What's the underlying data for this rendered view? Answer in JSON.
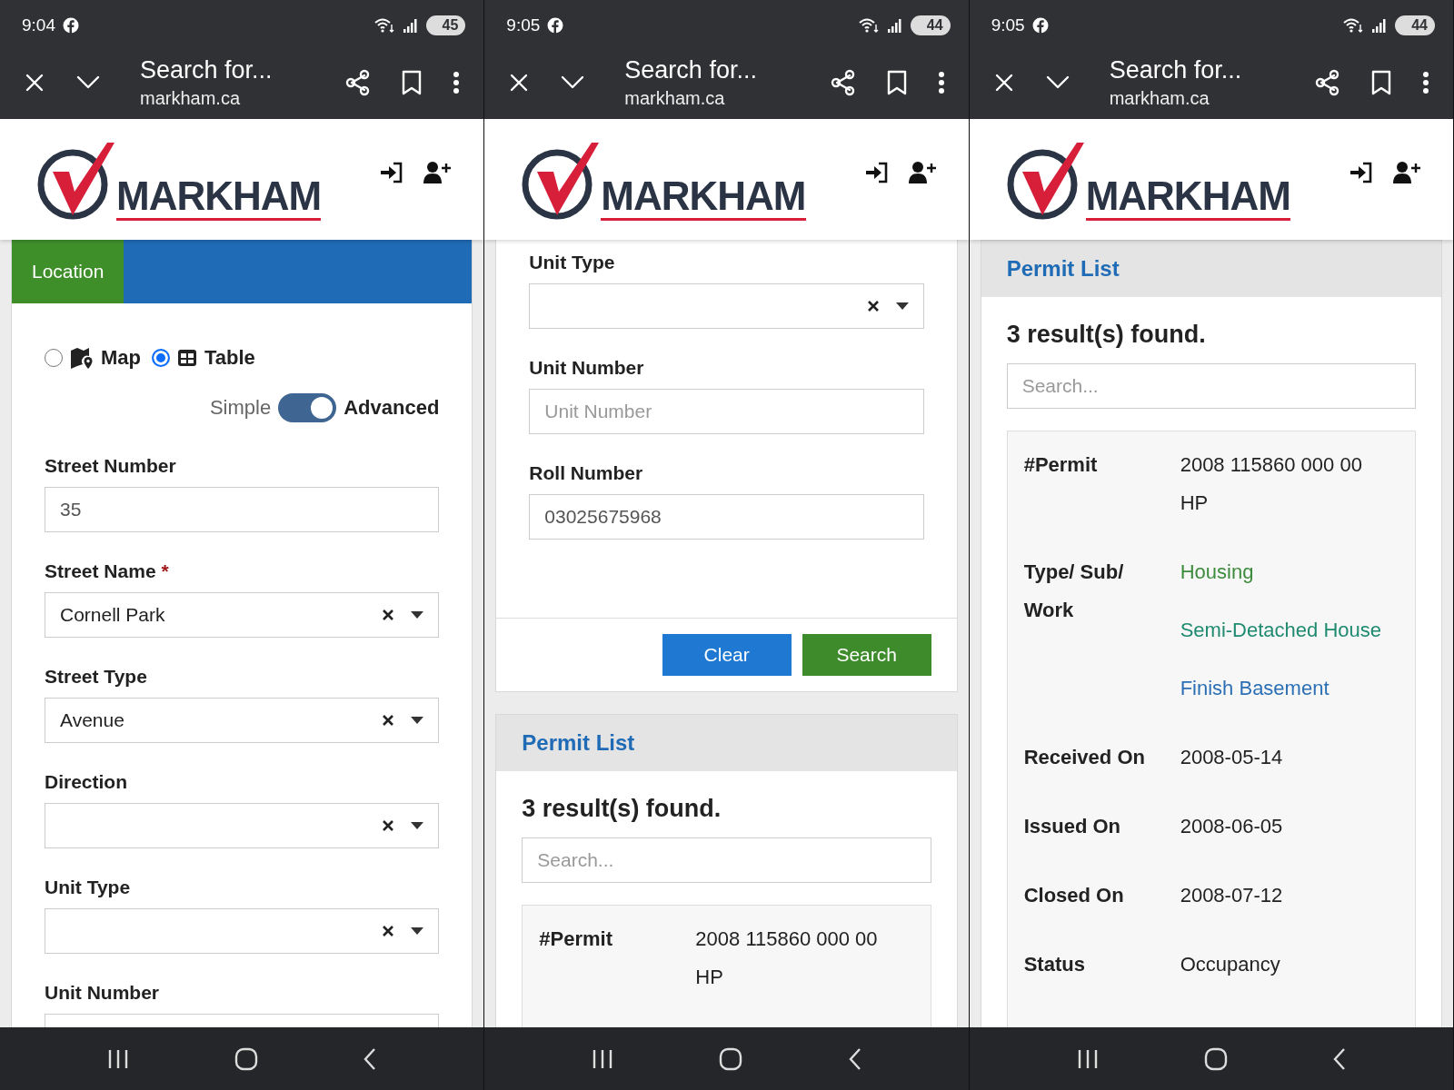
{
  "screens": [
    {
      "status_bar": {
        "time": "9:04",
        "battery": "45"
      },
      "browser_bar": {
        "title": "Search for...",
        "url": "markham.ca"
      },
      "site_header": {
        "logo": "MARKHAM"
      },
      "cards": [
        {
          "tabs": [
            {
              "label": "Location",
              "selected": true
            }
          ],
          "blocks": [
            {
              "kind": "view-switch",
              "options": [
                {
                  "kind": "map",
                  "label": "Map",
                  "selected": false
                },
                {
                  "kind": "table",
                  "label": "Table",
                  "selected": true
                }
              ]
            },
            {
              "kind": "toggle",
              "off_label": "Simple",
              "on_label": "Advanced",
              "on": true
            },
            {
              "kind": "text",
              "label": "Street Number",
              "value": "35"
            },
            {
              "kind": "select",
              "label": "Street Name",
              "required_mark": "*",
              "value": "Cornell Park"
            },
            {
              "kind": "select",
              "label": "Street Type",
              "value": "Avenue"
            },
            {
              "kind": "select",
              "label": "Direction"
            },
            {
              "kind": "select",
              "label": "Unit Type"
            },
            {
              "kind": "text",
              "label": "Unit Number"
            }
          ]
        }
      ]
    },
    {
      "status_bar": {
        "time": "9:05",
        "battery": "44"
      },
      "browser_bar": {
        "title": "Search for...",
        "url": "markham.ca"
      },
      "site_header": {
        "logo": "MARKHAM"
      },
      "cards": [
        {
          "blocks": [
            {
              "kind": "select",
              "label": "Unit Type"
            },
            {
              "kind": "text",
              "label": "Unit Number",
              "placeholder": "Unit Number"
            },
            {
              "kind": "text",
              "label": "Roll Number",
              "value": "03025675968"
            }
          ],
          "actions": [
            {
              "kind": "secondary",
              "label": "Clear"
            },
            {
              "kind": "primary",
              "label": "Search"
            }
          ]
        },
        {
          "heading": "Permit List",
          "result_count": "3 result(s) found.",
          "search": {
            "placeholder": "Search..."
          },
          "record": [
            {
              "label": "#Permit",
              "values": [
                {
                  "text": "2008 115860 000 00 HP"
                }
              ]
            }
          ]
        }
      ]
    },
    {
      "status_bar": {
        "time": "9:05",
        "battery": "44"
      },
      "browser_bar": {
        "title": "Search for...",
        "url": "markham.ca"
      },
      "site_header": {
        "logo": "MARKHAM"
      },
      "cards": [
        {
          "heading": "Permit List",
          "result_count": "3 result(s) found.",
          "search": {
            "placeholder": "Search..."
          },
          "record": [
            {
              "label": "#Permit",
              "values": [
                {
                  "text": "2008 115860 000 00 HP"
                }
              ]
            },
            {
              "label": "Type/ Sub/ Work",
              "values": [
                {
                  "text": "Housing",
                  "color": "#3d8b3d"
                },
                {
                  "text": "Semi-Detached House",
                  "color": "#1f8a70"
                },
                {
                  "text": "Finish Basement",
                  "color": "#2c6fb5"
                }
              ]
            },
            {
              "label": "Received On",
              "values": [
                {
                  "text": "2008-05-14"
                }
              ]
            },
            {
              "label": "Issued On",
              "values": [
                {
                  "text": "2008-06-05"
                }
              ]
            },
            {
              "label": "Closed On",
              "values": [
                {
                  "text": "2008-07-12"
                }
              ]
            },
            {
              "label": "Status",
              "values": [
                {
                  "text": "Occupancy"
                }
              ]
            }
          ]
        }
      ]
    }
  ]
}
